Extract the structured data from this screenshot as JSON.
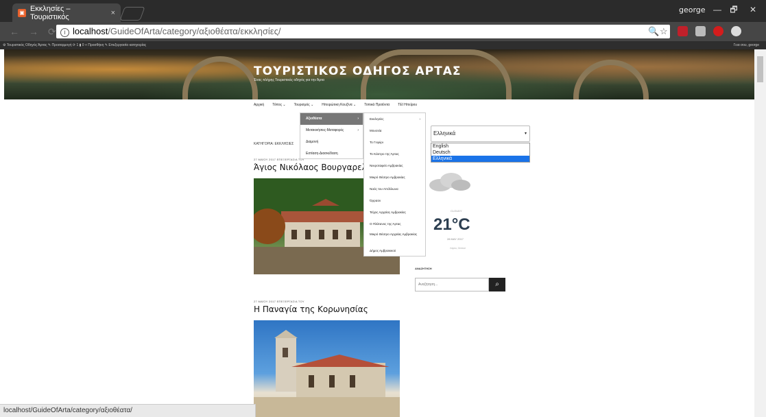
{
  "browser": {
    "tab_title": "Εκκλησίες – Τουριστικός",
    "tab_close": "×",
    "profile_name": "george",
    "win_controls": {
      "minimize": "—",
      "restore": "🗗",
      "close": "✕"
    },
    "url_host": "localhost",
    "url_path": "/GuideOfArta/category/αξιοθέατα/εκκλησίες/",
    "zoom_icon": "🔍",
    "star_icon": "☆",
    "status_url": "localhost/GuideOfArta/category/αξιοθέατα/"
  },
  "admin_bar": {
    "left": "⚙  Τουριστικός Οδηγός Άρτας   ✎ Προσαρμογή   ⟳ 1   ▮ 0   + Προσθήκη   ✎ Επεξεργασία κατηγορίας",
    "right": "Γεια σου, george"
  },
  "site": {
    "title": "ΤΟΥΡΙΣΤΙΚΟΣ ΟΔΗΓΟΣ ΑΡΤΑΣ",
    "tagline": "Ένας πλήρης Τουριστικός οδηγός για την Άρτα"
  },
  "nav": {
    "items": [
      "Αρχική",
      "Τόπος ⌄",
      "Τουρισμός ⌄",
      "Ηπειρώτικη Κουζίνα ⌄",
      "Τοπικά Προϊόντα",
      "ΤΕΙ Ηπείρου"
    ]
  },
  "dropdown1": {
    "items": [
      {
        "label": "Αξιοθέατα",
        "arrow": "›"
      },
      {
        "label": "Μετακινήσεις-Μεταφορές",
        "arrow": "›"
      },
      {
        "label": "Διαμονή",
        "arrow": ""
      },
      {
        "label": "Εστίαση-Διασκέδαση",
        "arrow": ""
      }
    ]
  },
  "dropdown2": {
    "items": [
      {
        "label": "Εκκλησίες",
        "arrow": "›"
      },
      {
        "label": "Μουσεία"
      },
      {
        "label": "Το Γεφύρι"
      },
      {
        "label": "Το Κάστρο της Άρτας"
      },
      {
        "label": "Νεκροταφείο Αμβρακίας"
      },
      {
        "label": "Μικρό Θέατρο Αμβρακίας"
      },
      {
        "label": "Ναός του Απόλλωνα"
      },
      {
        "label": "Όρραον"
      },
      {
        "label": "Τείχος Αρχαίας Αμβρακίας"
      },
      {
        "label": "Ο Πλάτανος της Άρτας"
      },
      {
        "label": "Μικρό Θέατρο Αρχαίας Αμβρακίας"
      },
      {
        "label": "Δήμος Αμβρακικού"
      }
    ]
  },
  "category_label": "ΚΑΤΗΓΟΡΙΑ: ΕΚΚΛΗΣΙΕΣ",
  "posts": [
    {
      "meta": "27 ΜΑΪΟΥ 2017   ΕΠΕΞΕΡΓΑΣΙΑ ΤΟΥ",
      "title": "Άγιος Νικόλαος Βουργαρελίου"
    },
    {
      "meta": "27 ΜΑΪΟΥ 2017   ΕΠΕΞΕΡΓΑΣΙΑ ΤΟΥ",
      "title": "Η Παναγία της Κορωνησίας"
    }
  ],
  "language": {
    "selected": "Ελληνικά",
    "options": [
      "English",
      "Deutsch",
      "Ελληνικά"
    ]
  },
  "weather": {
    "label": "CLOUDY",
    "temp": "21°C",
    "date": "28 MAY 2017",
    "place": "Λάρτα, Greece"
  },
  "search": {
    "label": "ΑΝΑΖΗΤΗΣΗ",
    "placeholder": "Αναζήτηση...",
    "button_icon": "⌕"
  },
  "colors": {
    "chrome_dark": "#2b2b2b",
    "menu_active": "#777777",
    "lang_selected": "#1a73e8"
  }
}
